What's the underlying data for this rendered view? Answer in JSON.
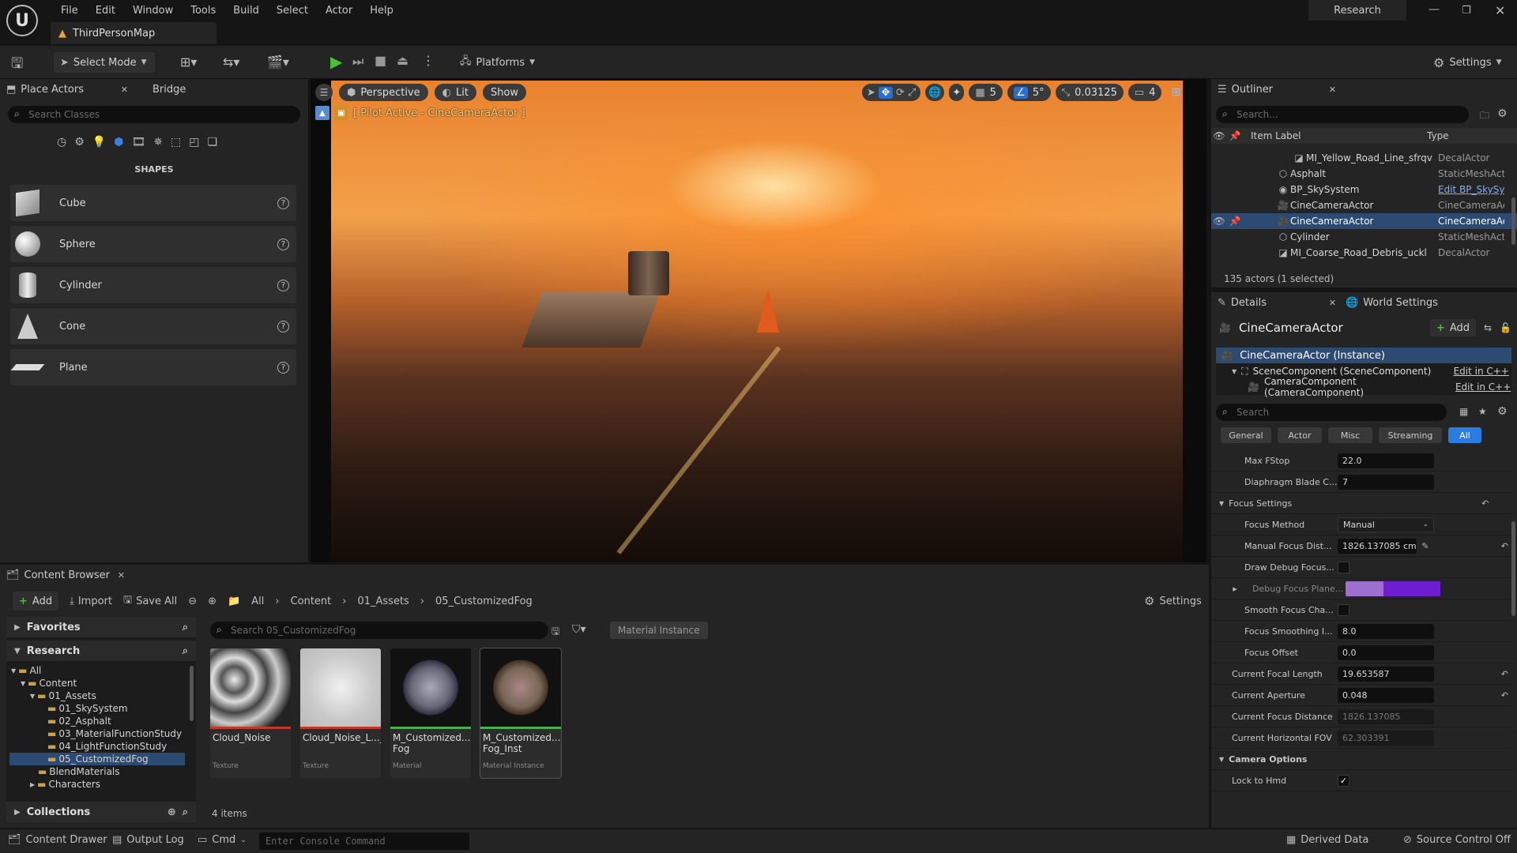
{
  "menu": [
    "File",
    "Edit",
    "Window",
    "Tools",
    "Build",
    "Select",
    "Actor",
    "Help"
  ],
  "window": {
    "map_tab": "ThirdPersonMap",
    "research_label": "Research"
  },
  "toolbar": {
    "select_mode": "Select Mode",
    "platforms": "Platforms",
    "settings": "Settings"
  },
  "place_actors": {
    "tab": "Place Actors",
    "bridge_tab": "Bridge",
    "search_placeholder": "Search Classes",
    "section": "SHAPES",
    "shapes": [
      {
        "label": "Cube"
      },
      {
        "label": "Sphere"
      },
      {
        "label": "Cylinder"
      },
      {
        "label": "Cone"
      },
      {
        "label": "Plane"
      }
    ]
  },
  "viewport": {
    "perspective": "Perspective",
    "lit": "Lit",
    "show": "Show",
    "pilot_label": "[ Pilot Active - CineCameraActor ]",
    "grid_value": "5",
    "angle_value": "5°",
    "scale_value": "0.03125",
    "camera_speed": "4"
  },
  "content_browser": {
    "tab": "Content Browser",
    "add": "Add",
    "import": "Import",
    "save_all": "Save All",
    "path": [
      "All",
      "Content",
      "01_Assets",
      "05_CustomizedFog"
    ],
    "settings": "Settings",
    "favorites": "Favorites",
    "research": "Research",
    "collections": "Collections",
    "search_placeholder": "Search 05_CustomizedFog",
    "filter_chip": "Material Instance",
    "items_count": "4 items",
    "tree": [
      {
        "label": "All",
        "level": 0
      },
      {
        "label": "Content",
        "level": 1
      },
      {
        "label": "01_Assets",
        "level": 2
      },
      {
        "label": "01_SkySystem",
        "level": 3
      },
      {
        "label": "02_Asphalt",
        "level": 3
      },
      {
        "label": "03_MaterialFunctionStudy",
        "level": 3
      },
      {
        "label": "04_LightFunctionStudy",
        "level": 3
      },
      {
        "label": "05_CustomizedFog",
        "level": 3
      },
      {
        "label": "BlendMaterials",
        "level": 2
      },
      {
        "label": "Characters",
        "level": 2
      }
    ],
    "assets": [
      {
        "name": "Cloud_Noise",
        "type": "Texture",
        "bar": "#c0392b"
      },
      {
        "name": "Cloud_Noise_L..._Contrast",
        "type": "Texture",
        "bar": "#c0392b"
      },
      {
        "name": "M_Customized... Fog",
        "type": "Material",
        "bar": "#4caf50"
      },
      {
        "name": "M_Customized... Fog_Inst",
        "type": "Material Instance",
        "bar": "#4caf50"
      }
    ]
  },
  "outliner": {
    "tab": "Outliner",
    "search_placeholder": "Search...",
    "col_label": "Item Label",
    "col_type": "Type",
    "rows": [
      {
        "label": "MI_Yellow_Road_Line_sfrqv",
        "type": "DecalActor"
      },
      {
        "label": "Asphalt",
        "type": "StaticMeshAct"
      },
      {
        "label": "BP_SkySystem",
        "type": "Edit BP_SkySy"
      },
      {
        "label": "CineCameraActor",
        "type": "CineCameraAc"
      },
      {
        "label": "CineCameraActor",
        "type": "CineCameraAc"
      },
      {
        "label": "Cylinder",
        "type": "StaticMeshAct"
      },
      {
        "label": "MI_Coarse_Road_Debris_uckl",
        "type": "DecalActor"
      }
    ],
    "count": "135 actors (1 selected)"
  },
  "details": {
    "tab": "Details",
    "world_tab": "World Settings",
    "actor_name": "CineCameraActor",
    "add": "Add",
    "instance": "CineCameraActor (Instance)",
    "components": [
      {
        "label": "SceneComponent (SceneComponent)",
        "edit": "Edit in C++"
      },
      {
        "label": "CameraComponent (CameraComponent)",
        "edit": "Edit in C++"
      }
    ],
    "search_placeholder": "Search",
    "filters": [
      "General",
      "Actor",
      "Misc",
      "Streaming",
      "All"
    ],
    "props": {
      "max_fstop": {
        "label": "Max FStop",
        "value": "22.0"
      },
      "blade": {
        "label": "Diaphragm Blade C...",
        "value": "7"
      },
      "focus_settings": "Focus Settings",
      "focus_method": {
        "label": "Focus Method",
        "value": "Manual"
      },
      "manual_focus": {
        "label": "Manual Focus Dist...",
        "value": "1826.137085 cm"
      },
      "draw_debug": {
        "label": "Draw Debug Focus..."
      },
      "debug_plane": {
        "label": "Debug Focus Plane..."
      },
      "smooth": {
        "label": "Smooth Focus Cha..."
      },
      "smoothing": {
        "label": "Focus Smoothing I...",
        "value": "8.0"
      },
      "offset": {
        "label": "Focus Offset",
        "value": "0.0"
      },
      "focal": {
        "label": "Current Focal Length",
        "value": "19.653587"
      },
      "aperture": {
        "label": "Current Aperture",
        "value": "0.048"
      },
      "focus_dist": {
        "label": "Current Focus Distance",
        "value": "1826.137085"
      },
      "fov": {
        "label": "Current Horizontal FOV",
        "value": "62.303391"
      },
      "camera_options": "Camera Options",
      "lock": {
        "label": "Lock to Hmd"
      }
    }
  },
  "status": {
    "drawer": "Content Drawer",
    "output": "Output Log",
    "cmd": "Cmd",
    "console_placeholder": "Enter Console Command",
    "derived": "Derived Data",
    "source": "Source Control Off"
  }
}
